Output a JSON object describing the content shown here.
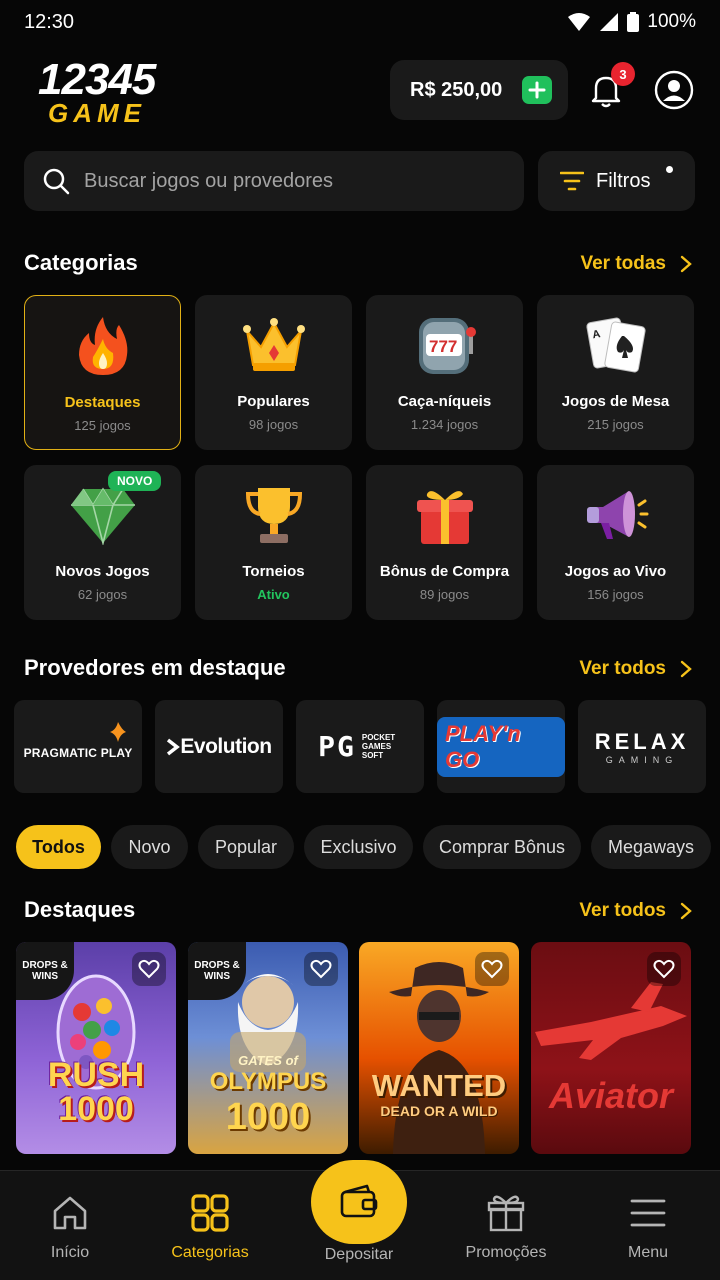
{
  "status_bar": {
    "time": "12:30",
    "battery": "100%"
  },
  "header": {
    "logo_top": "12345",
    "logo_bottom": "GAME",
    "balance": "R$ 250,00",
    "notification_count": "3"
  },
  "search": {
    "placeholder": "Buscar jogos ou provedores",
    "filters_label": "Filtros"
  },
  "categories_section": {
    "title": "Categorias",
    "see_all": "Ver todas",
    "items": [
      {
        "name": "Destaques",
        "sub": "125 jogos",
        "icon": "fire-icon"
      },
      {
        "name": "Populares",
        "sub": "98 jogos",
        "icon": "crown-icon"
      },
      {
        "name": "Caça-níqueis",
        "sub": "1.234 jogos",
        "icon": "slot-machine-icon"
      },
      {
        "name": "Jogos de Mesa",
        "sub": "215 jogos",
        "icon": "playing-cards-icon"
      },
      {
        "name": "Novos Jogos",
        "sub": "62 jogos",
        "icon": "diamond-icon",
        "badge": "NOVO"
      },
      {
        "name": "Torneios",
        "sub": "Ativo",
        "icon": "trophy-icon"
      },
      {
        "name": "Bônus de Compra",
        "sub": "89 jogos",
        "icon": "gift-icon"
      },
      {
        "name": "Jogos ao Vivo",
        "sub": "156 jogos",
        "icon": "megaphone-icon"
      }
    ]
  },
  "providers_section": {
    "title": "Provedores em destaque",
    "see_all": "Ver todos",
    "items": [
      {
        "name": "PRAGMATIC PLAY"
      },
      {
        "name": "Evolution"
      },
      {
        "name": "PG",
        "sub": "POCKET GAMES SOFT"
      },
      {
        "name": "PLAY'n GO"
      },
      {
        "name": "RELAX",
        "sub": "GAMING"
      }
    ]
  },
  "filters_chips": [
    "Todos",
    "Novo",
    "Popular",
    "Exclusivo",
    "Comprar Bônus",
    "Megaways"
  ],
  "featured_section": {
    "title": "Destaques",
    "see_all": "Ver todos",
    "games": [
      {
        "title_line1": "RUSH",
        "title_line2": "1000",
        "drops": "DROPS & WINS"
      },
      {
        "title_small": "GATES of",
        "title_line1": "OLYMPUS",
        "title_line2": "1000",
        "drops": "DROPS & WINS"
      },
      {
        "title_line1": "WANTED",
        "title_line2": "DEAD OR A WILD"
      },
      {
        "title_line1": "Aviator"
      }
    ]
  },
  "bottom_nav": {
    "items": [
      {
        "label": "Início",
        "icon": "home-icon"
      },
      {
        "label": "Categorias",
        "icon": "grid-icon"
      },
      {
        "label": "Depositar",
        "icon": "wallet-icon"
      },
      {
        "label": "Promoções",
        "icon": "gift-icon"
      },
      {
        "label": "Menu",
        "icon": "menu-icon"
      }
    ]
  },
  "colors": {
    "accent": "#f6c21a",
    "background": "#060606",
    "card": "#1a1a1a",
    "success": "#22c55e",
    "badge": "#e8242f"
  }
}
